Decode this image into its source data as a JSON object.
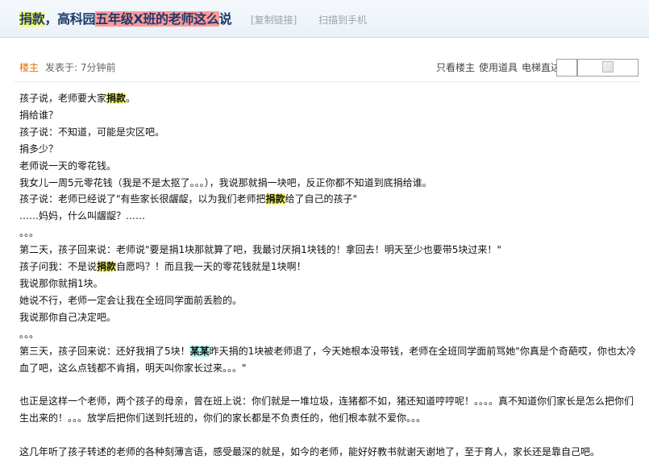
{
  "header": {
    "title_part1": "捐款",
    "title_part2": "，高科园",
    "title_part3": "五年级X班的老师这么",
    "title_part4": "说",
    "copy_link": "[复制链接]",
    "scan_to_phone": "扫描到手机"
  },
  "post_meta": {
    "floor": "楼主",
    "posted": "发表于: 7分钟前"
  },
  "post_tools": {
    "only_op": "只看楼主",
    "use_item": "使用道具",
    "elevator": "电梯直达"
  },
  "content": {
    "l1a": "孩子说，老师要大家",
    "l1b": "捐款",
    "l1c": "。",
    "l2": "捐给谁？",
    "l3": "孩子说：不知道，可能是灾区吧。",
    "l4": "捐多少？",
    "l5": "老师说一天的零花钱。",
    "l6": "我女儿一周5元零花钱（我是不是太抠了。。。），我说那就捐一块吧，反正你都不知道到底捐给谁。",
    "l7a": "孩子说：老师已经说了\"有些家长很龌龊，以为我们老师把",
    "l7b": "捐款",
    "l7c": "给了自己的孩子\"",
    "l8": "……妈妈，什么叫龌龊？……",
    "l9": "。。。",
    "l10": "第二天，孩子回来说：老师说\"要是捐1块那就算了吧，我最讨厌捐1块钱的！拿回去！明天至少也要带5块过来！\"",
    "l11a": "孩子问我：不是说",
    "l11b": "捐款",
    "l11c": "自愿吗？！而且我一天的零花钱就是1块啊！",
    "l12": "我说那你就捐1块。",
    "l13": "她说不行，老师一定会让我在全班同学面前丢脸的。",
    "l14": "我说那你自己决定吧。",
    "l15": "。。。",
    "l16a": "第三天，孩子回来说：还好我捐了5块！",
    "l16b": "某某",
    "l16c": "昨天捐的1块被老师退了，今天她根本没带钱，老师在全班同学面前骂她\"你真是个奇葩哎，你也太冷血了吧，这么点钱都不肯捐，明天叫你家长过来。。。\"",
    "l17": "也正是这样一个老师，两个孩子的母亲，曾在班上说：你们就是一堆垃圾，连猪都不如，猪还知道哼哼呢！。。。。真不知道你们家长是怎么把你们生出来的！。。。放学后把你们送到托班的，你们的家长都是不负责任的，他们根本就不爱你。。。",
    "l18": "这几年听了孩子转述的老师的各种刻薄言语，感受最深的就是，如今的老师，能好好教书就谢天谢地了，至于育人，家长还是靠自己吧。"
  }
}
